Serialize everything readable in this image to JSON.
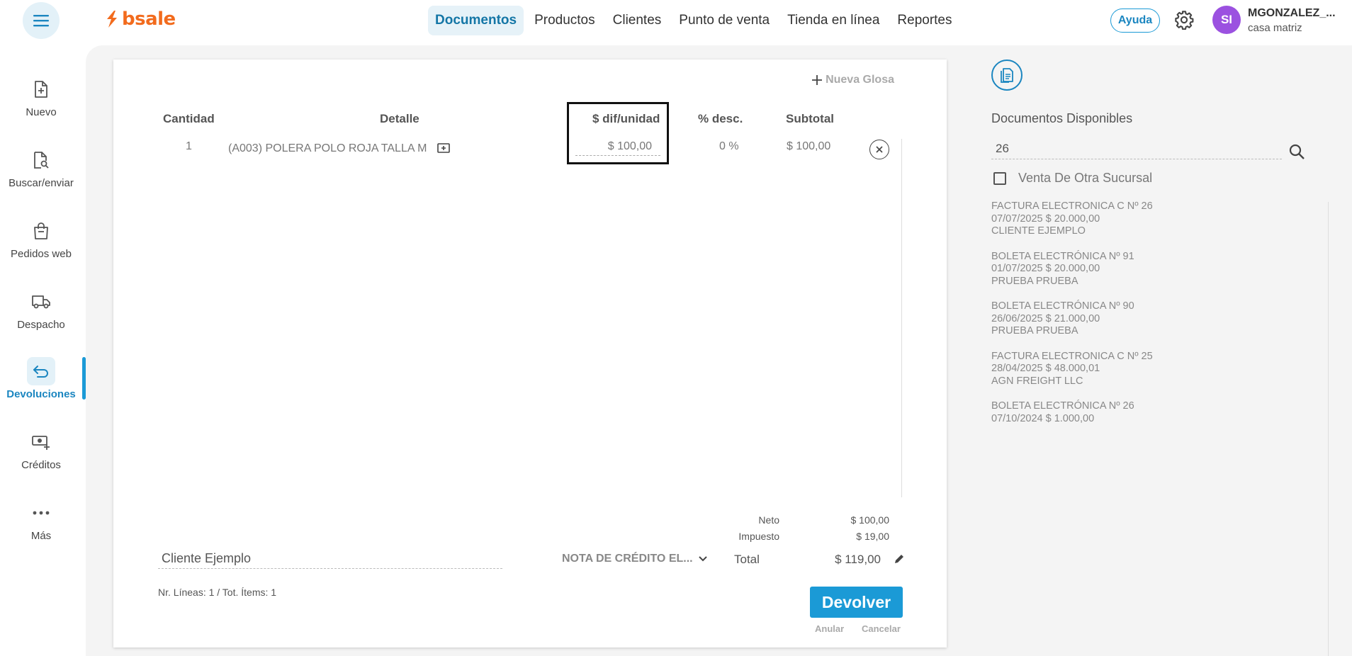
{
  "app": {
    "logo_text": "bsale",
    "brand_color": "#f26b1d",
    "accent_color": "#1b9ad6"
  },
  "topnav": {
    "items": [
      {
        "label": "Documentos",
        "active": true
      },
      {
        "label": "Productos"
      },
      {
        "label": "Clientes"
      },
      {
        "label": "Punto de venta"
      },
      {
        "label": "Tienda en línea"
      },
      {
        "label": "Reportes"
      }
    ],
    "help_label": "Ayuda",
    "avatar_initials": "SI",
    "user_name": "MGONZALEZ_...",
    "user_branch": "casa matriz"
  },
  "sidebar": {
    "items": [
      {
        "label": "Nuevo",
        "icon": "file-plus-icon"
      },
      {
        "label": "Buscar/enviar",
        "icon": "file-search-icon"
      },
      {
        "label": "Pedidos web",
        "icon": "shopping-bag-icon"
      },
      {
        "label": "Despacho",
        "icon": "truck-icon"
      },
      {
        "label": "Devoluciones",
        "icon": "return-arrow-icon",
        "active": true
      },
      {
        "label": "Créditos",
        "icon": "money-plus-icon"
      },
      {
        "label": "Más",
        "icon": "more-dots-icon"
      }
    ]
  },
  "document": {
    "nueva_glosa_label": "Nueva Glosa",
    "headers": {
      "cantidad": "Cantidad",
      "detalle": "Detalle",
      "dif_unidad": "$ dif/unidad",
      "desc": "% desc.",
      "subtotal": "Subtotal"
    },
    "rows": [
      {
        "cantidad": "1",
        "detalle": "(A003) POLERA POLO ROJA TALLA M",
        "dif_unidad": "$ 100,00",
        "desc": "0 %",
        "subtotal": "$ 100,00"
      }
    ],
    "totals": {
      "neto_label": "Neto",
      "neto_value": "$ 100,00",
      "impuesto_label": "Impuesto",
      "impuesto_value": "$ 19,00",
      "total_label": "Total",
      "total_value": "$ 119,00"
    },
    "client_value": "Cliente Ejemplo",
    "doc_type": "NOTA DE CRÉDITO EL...",
    "lines_info": "Nr. Líneas: 1 / Tot. Ítems: 1",
    "devolver_label": "Devolver",
    "anular_label": "Anular",
    "cancelar_label": "Cancelar"
  },
  "right_panel": {
    "title": "Documentos Disponibles",
    "search_value": "26",
    "checkbox_label": "Venta De Otra Sucursal",
    "documents": [
      {
        "line1": "FACTURA ELECTRONICA C Nº 26",
        "line2": "07/07/2025 $ 20.000,00",
        "line3": "CLIENTE EJEMPLO"
      },
      {
        "line1": "BOLETA ELECTRÓNICA Nº 91",
        "line2": "01/07/2025 $ 20.000,00",
        "line3": "PRUEBA PRUEBA"
      },
      {
        "line1": "BOLETA ELECTRÓNICA Nº 90",
        "line2": "26/06/2025 $ 21.000,00",
        "line3": "PRUEBA PRUEBA"
      },
      {
        "line1": "FACTURA ELECTRONICA C Nº 25",
        "line2": "28/04/2025 $ 48.000,01",
        "line3": "AGN FREIGHT LLC"
      },
      {
        "line1": "BOLETA ELECTRÓNICA Nº 26",
        "line2": "07/10/2024 $ 1.000,00",
        "line3": ""
      }
    ]
  }
}
